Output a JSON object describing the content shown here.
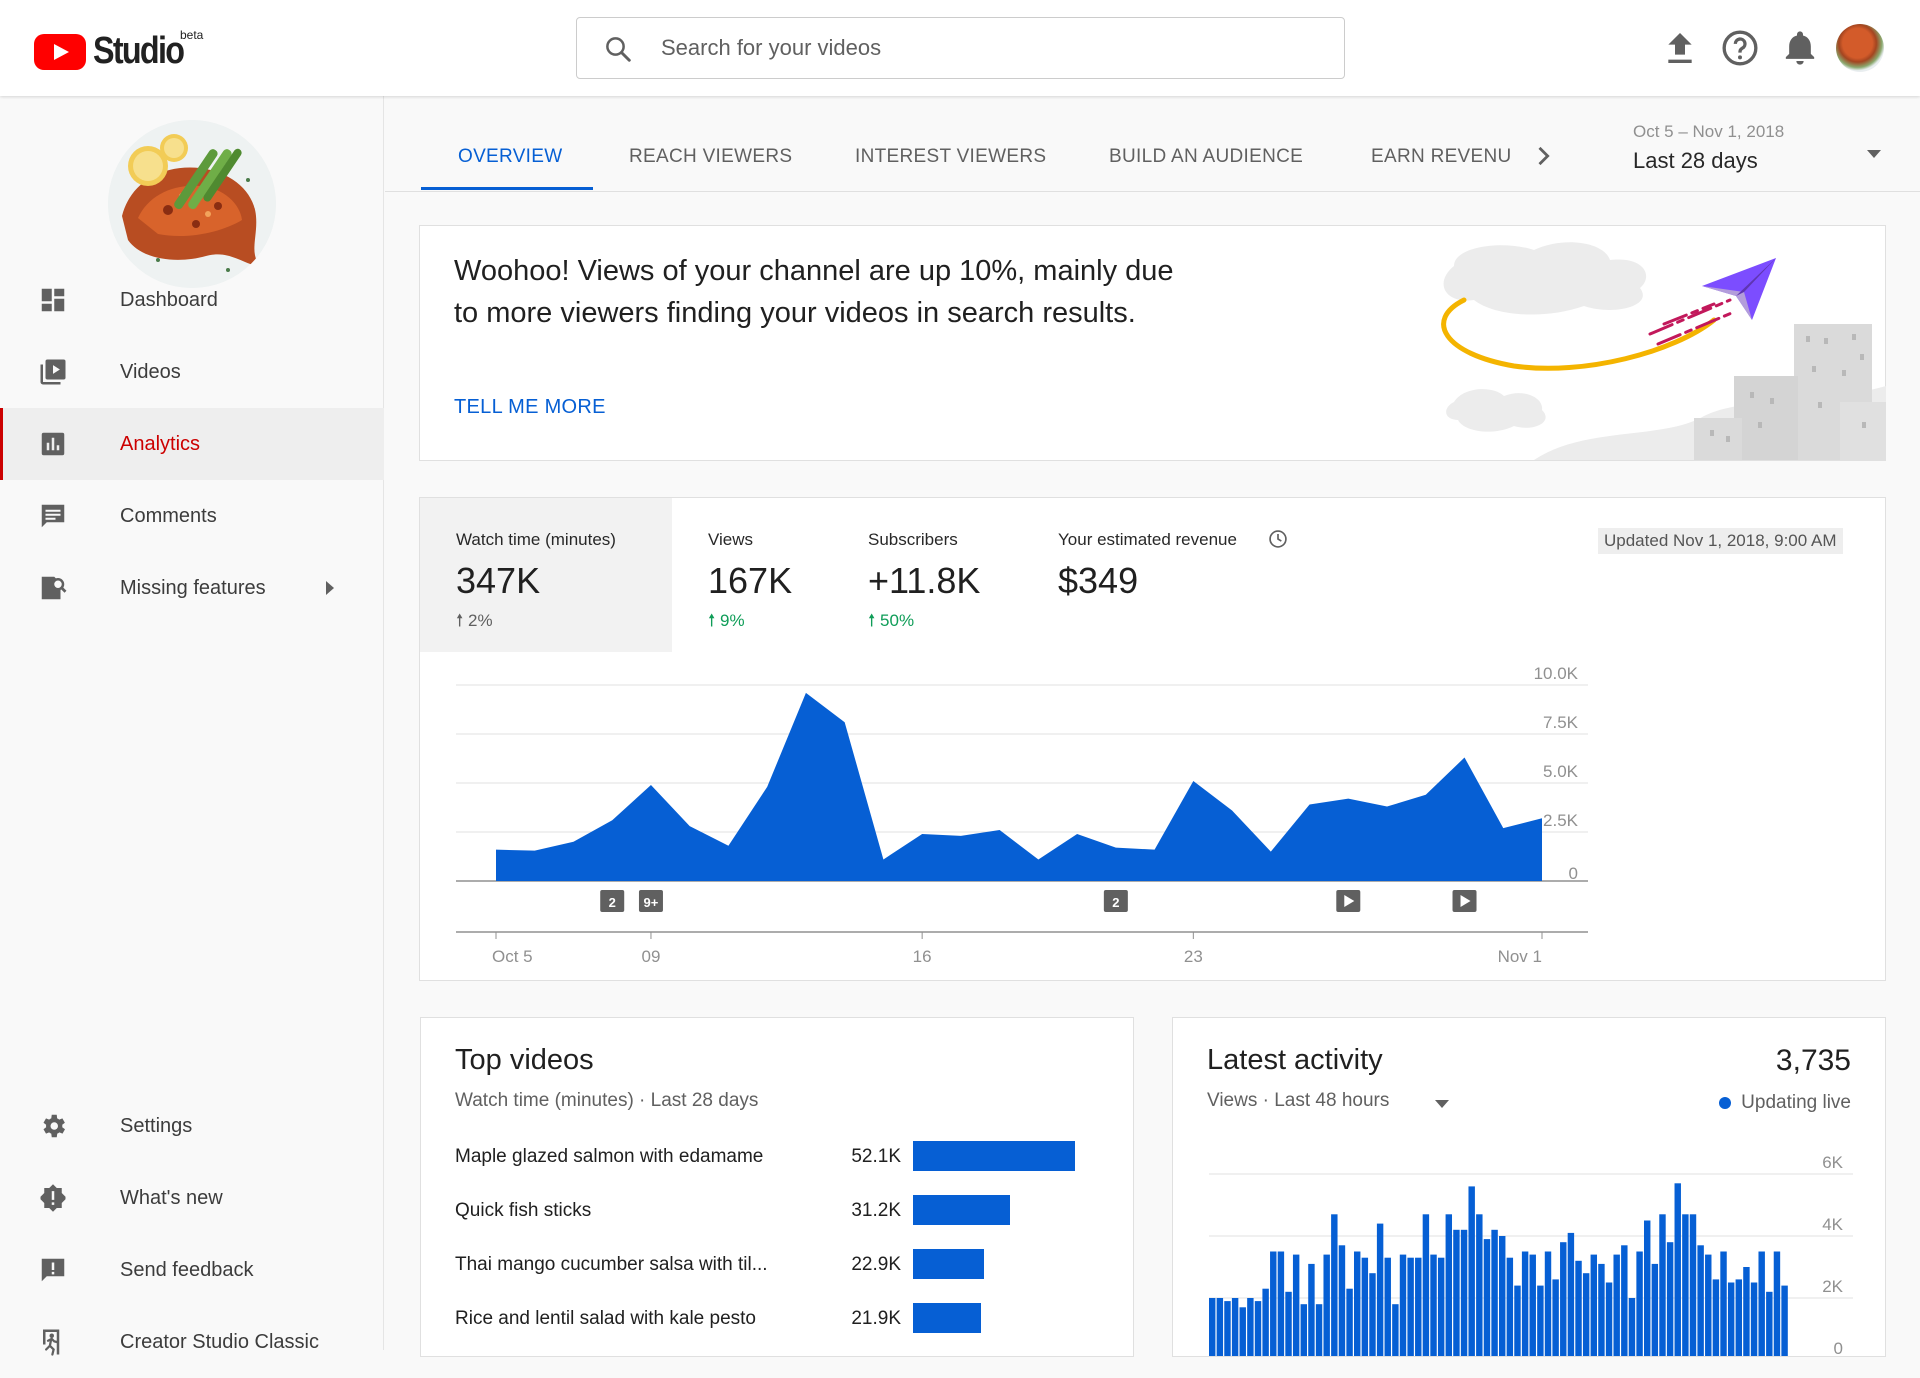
{
  "header": {
    "logo_text": "Studio",
    "logo_badge": "beta",
    "search_placeholder": "Search for your videos"
  },
  "sidebar": {
    "items": [
      {
        "label": "Dashboard",
        "icon": "dashboard-icon"
      },
      {
        "label": "Videos",
        "icon": "video-library-icon"
      },
      {
        "label": "Analytics",
        "icon": "analytics-icon"
      },
      {
        "label": "Comments",
        "icon": "comment-icon"
      },
      {
        "label": "Missing features",
        "icon": "missing-features-icon"
      }
    ],
    "bottom_items": [
      {
        "label": "Settings",
        "icon": "gear-icon"
      },
      {
        "label": "What's new",
        "icon": "whats-new-icon"
      },
      {
        "label": "Send feedback",
        "icon": "feedback-icon"
      },
      {
        "label": "Creator Studio Classic",
        "icon": "exit-icon"
      }
    ]
  },
  "tabs": {
    "items": [
      "OVERVIEW",
      "REACH VIEWERS",
      "INTEREST VIEWERS",
      "BUILD AN AUDIENCE",
      "EARN REVENU"
    ],
    "active": "OVERVIEW",
    "date_range": "Oct 5 – Nov 1, 2018",
    "period": "Last 28 days"
  },
  "insight": {
    "text": "Woohoo! Views of your channel are up 10%, mainly due to more viewers finding your videos in search results.",
    "link": "TELL ME MORE"
  },
  "metrics": {
    "items": [
      {
        "label": "Watch time (minutes)",
        "value": "347K",
        "delta": "2%",
        "trend": "neutral"
      },
      {
        "label": "Views",
        "value": "167K",
        "delta": "9%",
        "trend": "up"
      },
      {
        "label": "Subscribers",
        "value": "+11.8K",
        "delta": "50%",
        "trend": "up"
      },
      {
        "label": "Your estimated revenue",
        "value": "$349"
      }
    ],
    "updated": "Updated Nov 1, 2018, 9:00 AM",
    "colors": {
      "up": "#0f9d58",
      "neutral": "#606060",
      "series": "#065fd4"
    }
  },
  "chart_data": [
    {
      "type": "area",
      "title": "",
      "metric": "Watch time (minutes)",
      "x_tick_labels": [
        "Oct 5",
        "09",
        "16",
        "23",
        "Nov 1"
      ],
      "y_tick_labels": [
        "0",
        "2.5K",
        "5.0K",
        "7.5K",
        "10.0K"
      ],
      "ylim": [
        0,
        10000
      ],
      "x": [
        "Oct 5",
        "Oct 6",
        "Oct 7",
        "Oct 8",
        "Oct 9",
        "Oct 10",
        "Oct 11",
        "Oct 12",
        "Oct 13",
        "Oct 14",
        "Oct 15",
        "Oct 16",
        "Oct 17",
        "Oct 18",
        "Oct 19",
        "Oct 20",
        "Oct 21",
        "Oct 22",
        "Oct 23",
        "Oct 24",
        "Oct 25",
        "Oct 26",
        "Oct 27",
        "Oct 28",
        "Oct 29",
        "Oct 30",
        "Oct 31",
        "Nov 1"
      ],
      "values": [
        1600,
        1550,
        2000,
        3100,
        4900,
        2800,
        1800,
        4800,
        9600,
        8100,
        1100,
        2400,
        2300,
        2600,
        1100,
        2400,
        1700,
        1600,
        5100,
        3600,
        1500,
        3900,
        4200,
        3800,
        4400,
        6300,
        2700,
        3200
      ],
      "markers": [
        {
          "date": "Oct 8",
          "label": "2"
        },
        {
          "date": "Oct 9",
          "label": "9+"
        },
        {
          "date": "Oct 21",
          "label": "2"
        },
        {
          "date": "Oct 27",
          "icon": "play-icon"
        },
        {
          "date": "Oct 30",
          "icon": "play-icon"
        }
      ]
    },
    {
      "type": "bar",
      "title": "Top videos",
      "subtitle": "Watch time (minutes) · Last 28 days",
      "categories": [
        "Maple glazed salmon with edamame",
        "Quick fish sticks",
        "Thai mango cucumber salsa with til...",
        "Rice and lentil salad with kale pesto"
      ],
      "values": [
        52100,
        31200,
        22900,
        21900
      ],
      "value_labels": [
        "52.1K",
        "31.2K",
        "22.9K",
        "21.9K"
      ]
    },
    {
      "type": "bar",
      "title": "Latest activity",
      "subtitle": "Views · Last 48 hours",
      "total": "3,735",
      "status": "Updating live",
      "y_tick_labels": [
        "0",
        "2K",
        "4K",
        "6K"
      ],
      "ylim": [
        0,
        6000
      ],
      "values": [
        2000,
        2000,
        1900,
        2000,
        1700,
        2000,
        1900,
        2300,
        3500,
        3500,
        2200,
        3400,
        1800,
        3100,
        1800,
        3400,
        4700,
        3700,
        2300,
        3500,
        3300,
        2800,
        4400,
        3300,
        1800,
        3400,
        3300,
        3300,
        4700,
        3400,
        3300,
        4700,
        4200,
        4200,
        5600,
        4700,
        3900,
        4200,
        4000,
        3300,
        2400,
        3500,
        3400,
        2400,
        3500,
        2600,
        3800,
        4100,
        3200,
        2800,
        3400,
        3100,
        2500,
        3400,
        3700,
        2000,
        3500,
        4500,
        3100,
        4700,
        3800,
        5700,
        4700,
        4700,
        3700,
        3400,
        2600,
        3500,
        2500,
        2600,
        3000,
        2500,
        3500,
        2200,
        3500,
        2400
      ]
    }
  ]
}
